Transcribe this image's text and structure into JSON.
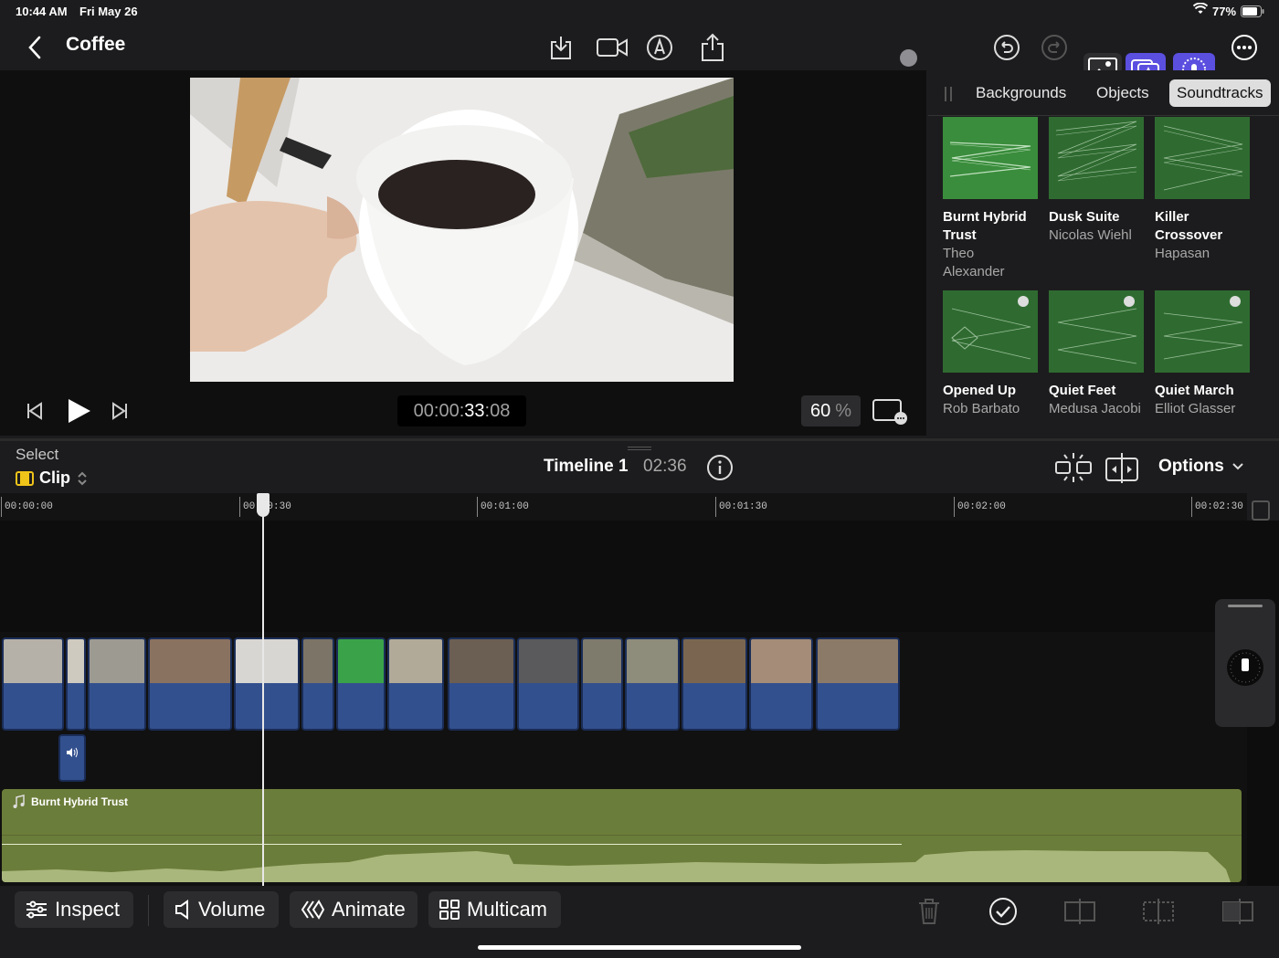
{
  "status": {
    "time": "10:44 AM",
    "date": "Fri May 26",
    "battery": "77%"
  },
  "project": {
    "title": "Coffee"
  },
  "viewer": {
    "timecode_prefix": "00:00:",
    "timecode_main": "33",
    "timecode_frames": ":08",
    "zoom_value": "60",
    "zoom_unit": "%"
  },
  "browser": {
    "tabs": [
      {
        "label": "Backgrounds"
      },
      {
        "label": "Objects"
      },
      {
        "label": "Soundtracks"
      }
    ],
    "active_tab": "Soundtracks",
    "items": [
      {
        "title": "Burnt Hybrid Trust",
        "artist": "Theo Alexander"
      },
      {
        "title": "Dusk Suite",
        "artist": "Nicolas Wiehl"
      },
      {
        "title": "Killer Crossover",
        "artist": "Hapasan"
      },
      {
        "title": "Opened Up",
        "artist": "Rob Barbato"
      },
      {
        "title": "Quiet Feet",
        "artist": "Medusa Jacobi"
      },
      {
        "title": "Quiet March",
        "artist": "Elliot Glasser"
      }
    ]
  },
  "timeline": {
    "select_label": "Select",
    "select_mode": "Clip",
    "name": "Timeline 1",
    "duration": "02:36",
    "options_label": "Options",
    "ruler": [
      "00:00:00",
      "00:00:30",
      "00:01:00",
      "00:01:30",
      "00:02:00",
      "00:02:30"
    ],
    "soundtrack_label": "Burnt Hybrid Trust"
  },
  "toolbar": {
    "inspect": "Inspect",
    "volume": "Volume",
    "animate": "Animate",
    "multicam": "Multicam"
  },
  "colors": {
    "accent_purple": "#5b4fe0",
    "clip_blue": "#33508e",
    "soundtrack_green": "#6b7d3a",
    "selected_tab": "#dedede"
  }
}
